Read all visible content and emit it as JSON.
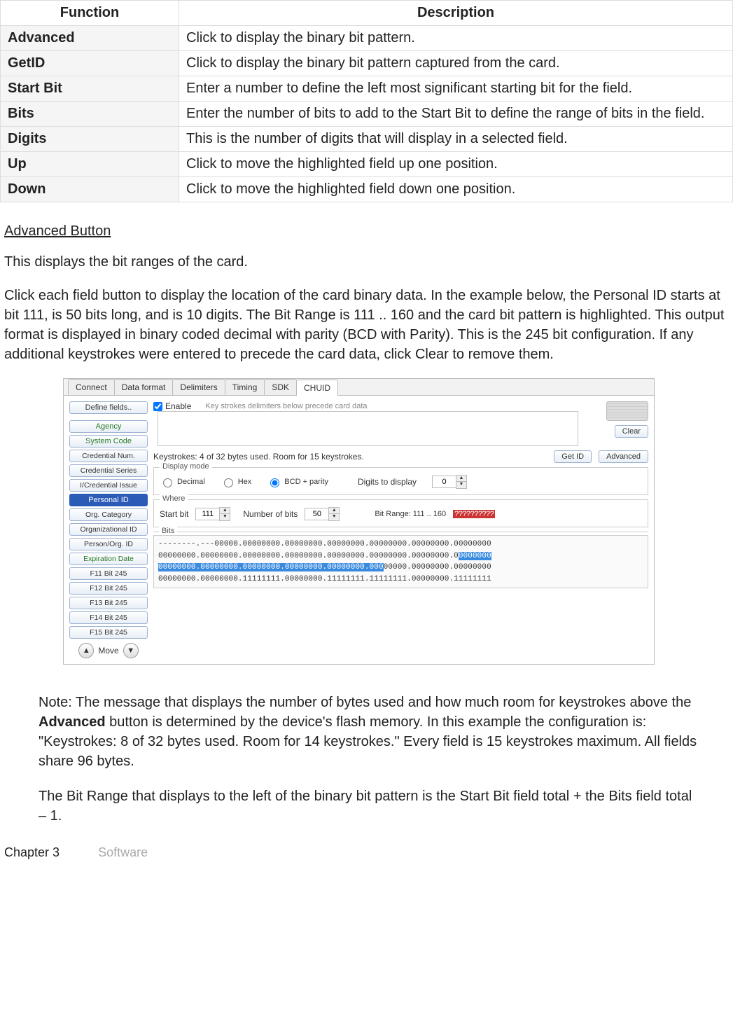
{
  "table": {
    "head": {
      "fn": "Function",
      "desc": "Description"
    },
    "rows": [
      {
        "fn": "Advanced",
        "desc": "Click to display the binary bit pattern."
      },
      {
        "fn": "GetID",
        "desc": "Click to display the binary bit pattern captured from the card."
      },
      {
        "fn": "Start Bit",
        "desc": "Enter a number to define the left most significant starting bit for the field."
      },
      {
        "fn": "Bits",
        "desc": "Enter the number of bits to add to the Start Bit to define the range of bits in the field."
      },
      {
        "fn": "Digits",
        "desc": "This is the number of digits that will display in a selected field."
      },
      {
        "fn": "Up",
        "desc": "Click to move the highlighted field up one position."
      },
      {
        "fn": "Down",
        "desc": "Click to move the highlighted field down one position."
      }
    ]
  },
  "prose": {
    "heading": "Advanced Button",
    "p1": "This displays the bit ranges of the card.",
    "p2": "Click each field button to display the location of the card binary data. In the example below, the Personal ID starts at bit 111, is 50 bits long, and is 10 digits. The Bit Range is 111 .. 160 and the card bit pattern is highlighted. This output format is displayed in binary coded decimal with parity (BCD with Parity). This is the 245 bit configuration. If any additional keystrokes were entered to precede the card data, click Clear to remove them."
  },
  "shot": {
    "tabs": [
      "Connect",
      "Data format",
      "Delimiters",
      "Timing",
      "SDK",
      "CHUID"
    ],
    "activeTab": 5,
    "left": {
      "define": "Define fields..",
      "items": [
        {
          "t": "Agency",
          "cls": "green"
        },
        {
          "t": "System Code",
          "cls": "green"
        },
        {
          "t": "Credential Num.",
          "cls": ""
        },
        {
          "t": "Credential Series",
          "cls": ""
        },
        {
          "t": "I/Credential Issue",
          "cls": ""
        },
        {
          "t": "Personal ID",
          "cls": "sel"
        },
        {
          "t": "Org. Category",
          "cls": ""
        },
        {
          "t": "Organizational ID",
          "cls": ""
        },
        {
          "t": "Person/Org. ID",
          "cls": ""
        },
        {
          "t": "Expiration Date",
          "cls": "green"
        },
        {
          "t": "F11 Bit 245",
          "cls": ""
        },
        {
          "t": "F12 Bit 245",
          "cls": ""
        },
        {
          "t": "F13 Bit 245",
          "cls": ""
        },
        {
          "t": "F14 Bit 245",
          "cls": ""
        },
        {
          "t": "F15 Bit 245",
          "cls": ""
        }
      ],
      "move": "Move"
    },
    "right": {
      "enable": "Enable",
      "hint": "Key strokes delimiters below precede card data",
      "clear": "Clear",
      "bytesMsg": "Keystrokes: 4 of 32 bytes used. Room for 15 keystrokes.",
      "getid": "Get ID",
      "advanced": "Advanced",
      "display": {
        "legend": "Display mode",
        "decimal": "Decimal",
        "hex": "Hex",
        "bcd": "BCD + parity",
        "digitsLabel": "Digits to display",
        "digits": "0"
      },
      "where": {
        "legend": "Where",
        "startLabel": "Start bit",
        "start": "111",
        "numLabel": "Number of bits",
        "num": "50",
        "range": "Bit Range: 111 .. 160",
        "unk": "??????????"
      },
      "bits": {
        "legend": "Bits",
        "l1a": "--------.---00000.00000000.00000000.00000000.00000000.00000000.00000000",
        "l2a": "00000000.00000000.00000000.00000000.00000000.00000000.00000000.0",
        "l2b": "0000000",
        "l3a": "00000000.00000000.00000000.00000000.00000000.000",
        "l3b": "00000.00000000.00000000",
        "l4a": "00000000.00000000.11111111.00000000.11111111.11111111.00000000.11111111"
      }
    }
  },
  "notes": {
    "p1a": "Note: The message that displays the number of bytes used and how much room for keystrokes above the ",
    "p1b": "Advanced",
    "p1c": " button is determined by the device's flash memory. In this example the configuration is: \"Keystrokes: 8 of 32 bytes used. Room for 14 keystrokes.\" Every field is 15 keystrokes maximum. All fields share 96 bytes.",
    "p2": "The Bit Range that displays to the left of the binary bit pattern is the Start Bit field total + the Bits field total – 1."
  },
  "footer": {
    "chapter": "Chapter 3",
    "sw": "Software"
  }
}
